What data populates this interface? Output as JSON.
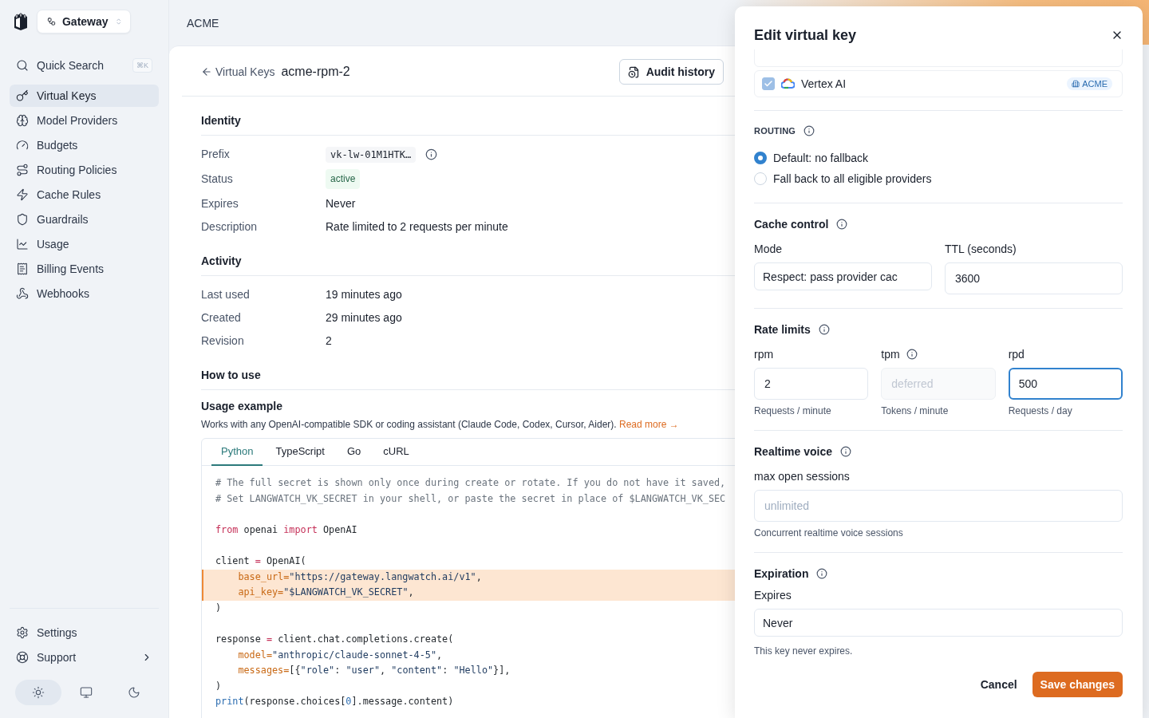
{
  "app": {
    "workspace": "Gateway",
    "org": "ACME"
  },
  "sidebar": {
    "search": {
      "label": "Quick Search",
      "shortcut": "⌘K"
    },
    "items": [
      {
        "label": "Virtual Keys",
        "selected": true
      },
      {
        "label": "Model Providers",
        "selected": false
      },
      {
        "label": "Budgets",
        "selected": false
      },
      {
        "label": "Routing Policies",
        "selected": false
      },
      {
        "label": "Cache Rules",
        "selected": false
      },
      {
        "label": "Guardrails",
        "selected": false
      },
      {
        "label": "Usage",
        "selected": false
      },
      {
        "label": "Billing Events",
        "selected": false
      },
      {
        "label": "Webhooks",
        "selected": false
      }
    ],
    "footer": [
      {
        "label": "Settings",
        "submenu": false
      },
      {
        "label": "Support",
        "submenu": true
      }
    ],
    "themes": [
      {
        "selected": true
      },
      {
        "selected": false
      },
      {
        "selected": false
      }
    ]
  },
  "header": {
    "back": "Virtual Keys",
    "title": "acme-rpm-2",
    "actions": [
      "Audit history"
    ]
  },
  "sections": [
    {
      "title": "Identity",
      "rows": [
        {
          "label": "Prefix",
          "value": "vk-lw-01M1HTK…",
          "kind": "code"
        },
        {
          "label": "Status",
          "value": "active",
          "kind": "badge"
        },
        {
          "label": "Expires",
          "value": "Never",
          "kind": "text"
        },
        {
          "label": "Description",
          "value": "Rate limited to 2 requests per minute",
          "kind": "text"
        }
      ]
    },
    {
      "title": "Activity",
      "rows": [
        {
          "label": "Last used",
          "value": "19 minutes ago",
          "kind": "text"
        },
        {
          "label": "Created",
          "value": "29 minutes ago",
          "kind": "text"
        },
        {
          "label": "Revision",
          "value": "2",
          "kind": "text"
        }
      ]
    },
    {
      "title": "How to use"
    }
  ],
  "usage": {
    "title": "Usage example",
    "description": "Works with any OpenAI-compatible SDK or coding assistant (Claude Code, Codex, Cursor, Aider).",
    "link": "Read more →",
    "tabs": [
      {
        "label": "Python",
        "selected": true
      },
      {
        "label": "TypeScript",
        "selected": false
      },
      {
        "label": "Go",
        "selected": false
      },
      {
        "label": "cURL",
        "selected": false
      }
    ],
    "code": [
      {
        "highlighted": false,
        "tokens": [
          {
            "kind": "comment",
            "text": "# The full secret is shown only once during create or rotate. If you do not have it saved,"
          }
        ]
      },
      {
        "highlighted": false,
        "tokens": [
          {
            "kind": "comment",
            "text": "# Set LANGWATCH_VK_SECRET in your shell, or paste the secret in place of $LANGWATCH_VK_SEC"
          }
        ]
      },
      {
        "highlighted": false
      },
      {
        "highlighted": false,
        "tokens": [
          {
            "kind": "keyword",
            "text": "from"
          },
          {
            "kind": "plain",
            "text": " openai "
          },
          {
            "kind": "keyword",
            "text": "import"
          },
          {
            "kind": "plain",
            "text": " OpenAI"
          }
        ]
      },
      {
        "highlighted": false
      },
      {
        "highlighted": false,
        "tokens": [
          {
            "kind": "plain",
            "text": "client "
          },
          {
            "kind": "op",
            "text": "="
          },
          {
            "kind": "plain",
            "text": " OpenAI("
          }
        ]
      },
      {
        "highlighted": true,
        "indent": true,
        "tokens": [
          {
            "kind": "param",
            "text": "base_url="
          },
          {
            "kind": "string",
            "text": "\"https://gateway.langwatch.ai/v1\""
          },
          {
            "kind": "plain",
            "text": ","
          }
        ]
      },
      {
        "highlighted": true,
        "indent": true,
        "tokens": [
          {
            "kind": "param",
            "text": "api_key="
          },
          {
            "kind": "string",
            "text": "\"$LANGWATCH_VK_SECRET\""
          },
          {
            "kind": "plain",
            "text": ","
          }
        ]
      },
      {
        "highlighted": false,
        "tokens": [
          {
            "kind": "plain",
            "text": ")"
          }
        ]
      },
      {
        "highlighted": false
      },
      {
        "highlighted": false,
        "tokens": [
          {
            "kind": "plain",
            "text": "response "
          },
          {
            "kind": "op",
            "text": "="
          },
          {
            "kind": "plain",
            "text": " client.chat.completions.create("
          }
        ]
      },
      {
        "highlighted": false,
        "indent": true,
        "tokens": [
          {
            "kind": "param",
            "text": "model="
          },
          {
            "kind": "string",
            "text": "\"anthropic/claude-sonnet-4-5\""
          },
          {
            "kind": "plain",
            "text": ","
          }
        ]
      },
      {
        "highlighted": false,
        "indent": true,
        "tokens": [
          {
            "kind": "param",
            "text": "messages="
          },
          {
            "kind": "plain",
            "text": "[{"
          },
          {
            "kind": "string",
            "text": "\"role\""
          },
          {
            "kind": "plain",
            "text": ": "
          },
          {
            "kind": "string",
            "text": "\"user\""
          },
          {
            "kind": "plain",
            "text": ", "
          },
          {
            "kind": "string",
            "text": "\"content\""
          },
          {
            "kind": "plain",
            "text": ": "
          },
          {
            "kind": "string",
            "text": "\"Hello\""
          },
          {
            "kind": "plain",
            "text": "}],"
          }
        ]
      },
      {
        "highlighted": false,
        "tokens": [
          {
            "kind": "plain",
            "text": ")"
          }
        ]
      },
      {
        "highlighted": false,
        "tokens": [
          {
            "kind": "builtin",
            "text": "print"
          },
          {
            "kind": "plain",
            "text": "(response.choices["
          },
          {
            "kind": "number",
            "text": "0"
          },
          {
            "kind": "plain",
            "text": "].message.content)"
          }
        ]
      }
    ]
  },
  "drawer": {
    "title": "Edit virtual key",
    "providers": [
      {
        "name": "Vertex AI",
        "checked": true,
        "badge": "ACME"
      }
    ],
    "routing": {
      "title": "ROUTING",
      "options": [
        {
          "label": "Default: no fallback",
          "selected": true
        },
        {
          "label": "Fall back to all eligible providers",
          "selected": false
        }
      ]
    },
    "cache": {
      "title": "Cache control",
      "fields": [
        {
          "label": "Mode",
          "value": "Respect: pass provider cac",
          "kind": "select"
        },
        {
          "label": "TTL (seconds)",
          "value": "3600",
          "kind": "input"
        }
      ]
    },
    "rate_limits": {
      "title": "Rate limits",
      "fields": [
        {
          "label": "rpm",
          "value": "2",
          "hint": "Requests / minute",
          "disabled": false,
          "focused": false
        },
        {
          "label": "tpm",
          "placeholder": "deferred",
          "hint": "Tokens / minute",
          "info": true,
          "disabled": true,
          "focused": false
        },
        {
          "label": "rpd",
          "value": "500",
          "hint": "Requests / day",
          "disabled": false,
          "focused": true
        }
      ]
    },
    "realtime": {
      "title": "Realtime voice",
      "label": "max open sessions",
      "placeholder": "unlimited",
      "hint": "Concurrent realtime voice sessions"
    },
    "expiration": {
      "title": "Expiration",
      "label": "Expires",
      "value": "Never",
      "hint": "This key never expires."
    },
    "buttons": {
      "cancel": "Cancel",
      "save": "Save changes"
    }
  }
}
